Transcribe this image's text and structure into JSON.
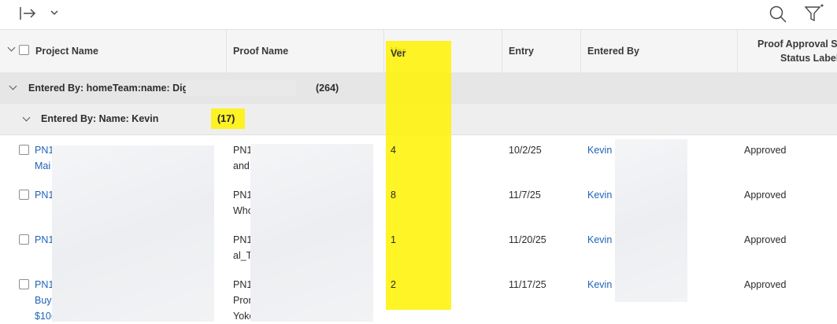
{
  "toolbar": {
    "icons": [
      "export-arrow-icon",
      "chevron-down-icon",
      "search-icon",
      "filter-icon"
    ]
  },
  "columns": [
    "Project Name",
    "Proof Name",
    "Ver",
    "Entry",
    "Entered By",
    "Proof Approval Sta",
    "Status Label"
  ],
  "groups": {
    "level1": {
      "label": "Entered By: homeTeam:name: Dig",
      "count": "(264)"
    },
    "level2": {
      "label": "Entered By: Name: Kevin",
      "count": "(17)"
    }
  },
  "rows": [
    {
      "project": [
        "PN1",
        "Mai"
      ],
      "proof": [
        "PN1",
        "and"
      ],
      "ver": "4",
      "entry": "10/2/25",
      "entered_by": "Kevin",
      "status": "Approved"
    },
    {
      "project": [
        "PN1",
        ""
      ],
      "proof": [
        "PN1",
        "Who"
      ],
      "ver": "8",
      "entry": "11/7/25",
      "entered_by": "Kevin",
      "status": "Approved"
    },
    {
      "project": [
        "PN1",
        ""
      ],
      "proof": [
        "PN1",
        "al_T"
      ],
      "ver": "1",
      "entry": "11/20/25",
      "entered_by": "Kevin",
      "status": "Approved"
    },
    {
      "project": [
        "PN1",
        "Buy",
        "$10("
      ],
      "proof": [
        "PN1",
        "Pror",
        "Yoko"
      ],
      "ver": "2",
      "entry": "11/17/25",
      "entered_by": "Kevin",
      "status": "Approved"
    }
  ],
  "highlight_color": "#fff200",
  "link_color": "#1f63b6"
}
